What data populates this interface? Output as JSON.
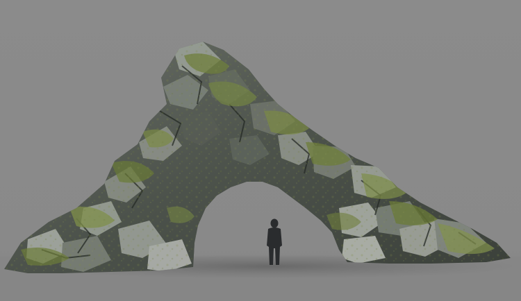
{
  "scene": {
    "subject": "rock-arch",
    "colors": {
      "background": "#8a8a8a",
      "ground": "#888888",
      "rock_dark": "#2f3430",
      "rock_mid": "#5d625c",
      "rock_light": "#a3a7a2",
      "moss": "#6f7f3c",
      "moss_light": "#8e9a4f",
      "person_silhouette": "#2a2c2e"
    }
  }
}
